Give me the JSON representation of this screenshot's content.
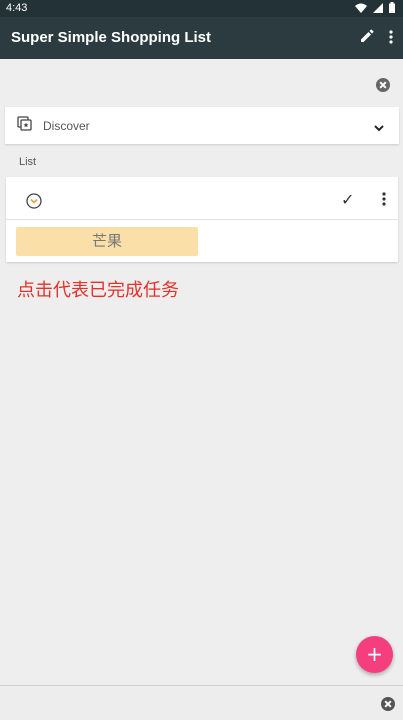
{
  "status_bar": {
    "time": "4:43",
    "icons": [
      "wifi-icon",
      "signal-icon",
      "battery-icon"
    ]
  },
  "app_bar": {
    "title": "Super Simple Shopping List",
    "actions": [
      "edit-icon",
      "more-vert-icon"
    ]
  },
  "discover": {
    "label": "Discover",
    "icon": "collection-star-icon"
  },
  "list_section": {
    "label": "List",
    "check_symbol": "✓",
    "items": [
      {
        "name": "芒果"
      }
    ]
  },
  "hint": {
    "text": "点击代表已完成任务"
  },
  "fab": {
    "symbol": "+"
  },
  "colors": {
    "status_bar": "#223237",
    "app_bar": "#2b3b40",
    "item_chip": "#fbdfa8",
    "hint_text": "#e5312a",
    "fab": "#f53e7e",
    "expand_icon": "#e6a23c"
  }
}
